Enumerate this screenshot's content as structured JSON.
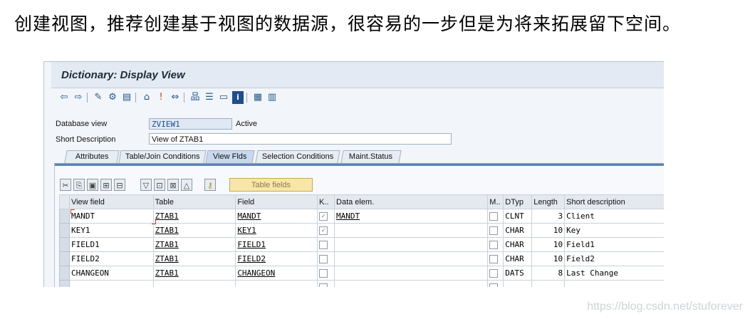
{
  "caption": "创建视图，推荐创建基于视图的数据源，很容易的一步但是为将来拓展留下空间。",
  "window": {
    "title": "Dictionary: Display View"
  },
  "toolbar": {
    "icons": [
      "back-icon",
      "forward-icon",
      "display-change-icon",
      "activate-icon",
      "object-list-icon",
      "where-used-icon",
      "stop-icon",
      "navigate-icon",
      "hierarchy-icon",
      "layout-icon",
      "frame-icon",
      "info-icon",
      "technical-settings-icon",
      "table-grid-icon"
    ]
  },
  "header": {
    "db_view_label": "Database view",
    "db_view_value": "ZVIEW1",
    "status": "Active",
    "short_desc_label": "Short Description",
    "short_desc_value": "View of ZTAB1"
  },
  "tabs": [
    "Attributes",
    "Table/Join Conditions",
    "View Flds",
    "Selection Conditions",
    "Maint.Status"
  ],
  "active_tab": "View Flds",
  "grid_toolbar": {
    "table_fields_button": "Table fields"
  },
  "grid": {
    "columns": [
      "View field",
      "Table",
      "Field",
      "K..",
      "Data elem.",
      "M..",
      "DTyp",
      "Length",
      "Short description"
    ],
    "rows": [
      {
        "view_field": "MANDT",
        "table": "ZTAB1",
        "field": "MANDT",
        "key": true,
        "data_elem": "MANDT",
        "mod": false,
        "dtyp": "CLNT",
        "length": "3",
        "desc": "Client"
      },
      {
        "view_field": "KEY1",
        "table": "ZTAB1",
        "field": "KEY1",
        "key": true,
        "data_elem": "",
        "mod": false,
        "dtyp": "CHAR",
        "length": "10",
        "desc": "Key"
      },
      {
        "view_field": "FIELD1",
        "table": "ZTAB1",
        "field": "FIELD1",
        "key": false,
        "data_elem": "",
        "mod": false,
        "dtyp": "CHAR",
        "length": "10",
        "desc": "Field1"
      },
      {
        "view_field": "FIELD2",
        "table": "ZTAB1",
        "field": "FIELD2",
        "key": false,
        "data_elem": "",
        "mod": false,
        "dtyp": "CHAR",
        "length": "10",
        "desc": "Field2"
      },
      {
        "view_field": "CHANGEON",
        "table": "ZTAB1",
        "field": "CHANGEON",
        "key": false,
        "data_elem": "",
        "mod": false,
        "dtyp": "DATS",
        "length": "8",
        "desc": "Last Change"
      }
    ]
  },
  "watermark": "https://blog.csdn.net/stuforever",
  "colors": {
    "accent": "#5e84b6",
    "title_bg": "#e3eaf3",
    "button_yellow": "#f8e6a9"
  }
}
